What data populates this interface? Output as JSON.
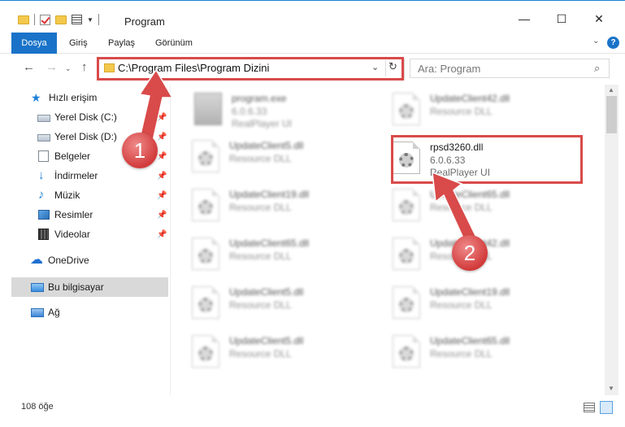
{
  "window": {
    "title": "Program",
    "minimize": "—",
    "maximize": "☐",
    "close": "✕"
  },
  "ribbon": {
    "tabs": [
      "Dosya",
      "Giriş",
      "Paylaş",
      "Görünüm"
    ],
    "help": "?"
  },
  "address": {
    "path": "C:\\Program Files\\Program Dizini",
    "search_placeholder": "Ara: Program"
  },
  "sidebar": {
    "items": [
      {
        "label": "Hızlı erişim",
        "icon": "star-icon",
        "pinned": false
      },
      {
        "label": "Yerel Disk (C:)",
        "icon": "drive-icon",
        "pinned": true
      },
      {
        "label": "Yerel Disk (D:)",
        "icon": "drive-icon",
        "pinned": true
      },
      {
        "label": "Belgeler",
        "icon": "document-icon",
        "pinned": true
      },
      {
        "label": "İndirmeler",
        "icon": "download-icon",
        "pinned": true
      },
      {
        "label": "Müzik",
        "icon": "music-icon",
        "pinned": true
      },
      {
        "label": "Resimler",
        "icon": "pictures-icon",
        "pinned": true
      },
      {
        "label": "Videolar",
        "icon": "video-icon",
        "pinned": true
      },
      {
        "label": "OneDrive",
        "icon": "cloud-icon",
        "pinned": false
      },
      {
        "label": "Bu bilgisayar",
        "icon": "computer-icon",
        "pinned": false,
        "selected": true
      },
      {
        "label": "Ağ",
        "icon": "network-icon",
        "pinned": false
      }
    ]
  },
  "files": {
    "left": [
      {
        "name": "program.exe",
        "line1": "6.0.6.33",
        "line2": "RealPlayer UI",
        "type": "exe"
      },
      {
        "name": "UpdateClient5.dll",
        "line1": "Resource DLL",
        "line2": "",
        "type": "dll"
      },
      {
        "name": "UpdateClient19.dll",
        "line1": "Resource DLL",
        "line2": "",
        "type": "dll"
      },
      {
        "name": "UpdateClient65.dll",
        "line1": "Resource DLL",
        "line2": "",
        "type": "dll"
      },
      {
        "name": "UpdateClient5.dll",
        "line1": "Resource DLL",
        "line2": "",
        "type": "dll"
      },
      {
        "name": "UpdateClient5.dll",
        "line1": "Resource DLL",
        "line2": "",
        "type": "dll"
      }
    ],
    "right": [
      {
        "name": "UpdateClient42.dll",
        "line1": "Resource DLL",
        "line2": "",
        "type": "dll"
      },
      {
        "name": "rpsd3260.dll",
        "line1": "6.0.6.33",
        "line2": "RealPlayer UI",
        "type": "dll",
        "highlighted": true
      },
      {
        "name": "UpdateClient65.dll",
        "line1": "Resource DLL",
        "line2": "",
        "type": "dll"
      },
      {
        "name": "UpdateClient42.dll",
        "line1": "Resource DLL",
        "line2": "",
        "type": "dll"
      },
      {
        "name": "UpdateClient19.dll",
        "line1": "Resource DLL",
        "line2": "",
        "type": "dll"
      },
      {
        "name": "UpdateClient65.dll",
        "line1": "Resource DLL",
        "line2": "",
        "type": "dll"
      }
    ]
  },
  "status": {
    "item_count": "108 öğe"
  },
  "annotations": {
    "step1": "1",
    "step2": "2",
    "color": "#d94a4a"
  }
}
